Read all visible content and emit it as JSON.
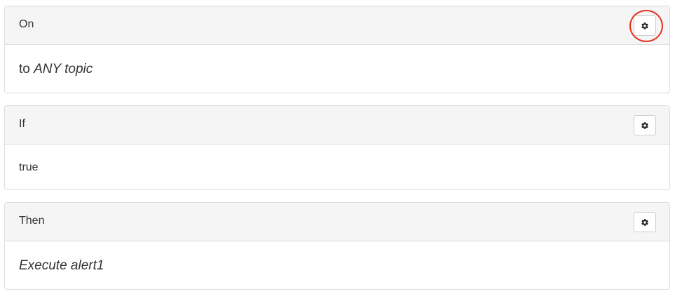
{
  "panels": [
    {
      "title": "On",
      "body_prefix": "to ",
      "body_emphasis": "ANY topic",
      "settings_icon": "gear-icon",
      "highlighted": true
    },
    {
      "title": "If",
      "body_text": "true",
      "settings_icon": "gear-icon",
      "highlighted": false
    },
    {
      "title": "Then",
      "body_emphasis": "Execute alert1",
      "settings_icon": "gear-icon",
      "highlighted": false
    }
  ],
  "colors": {
    "heading_bg": "#f5f5f5",
    "border": "#dddddd",
    "highlight_ring": "#e8311f",
    "text": "#333333"
  }
}
